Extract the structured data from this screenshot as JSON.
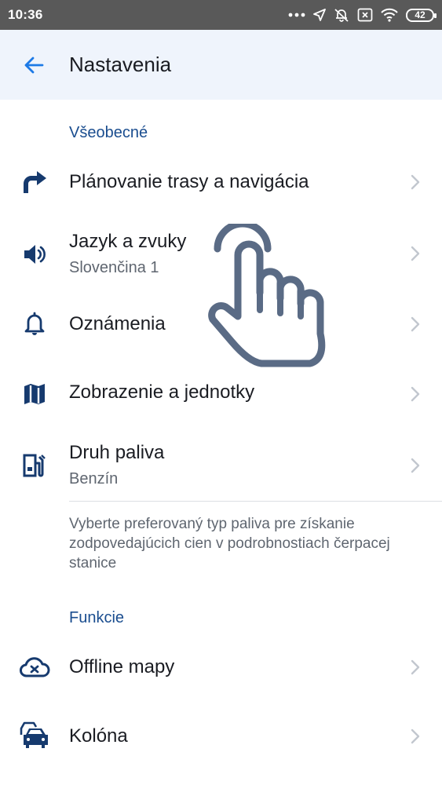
{
  "status_bar": {
    "time": "10:36",
    "battery": "42",
    "icons": [
      "more-dots-icon",
      "location-arrow-icon",
      "bell-off-icon",
      "sim-x-icon",
      "wifi-icon",
      "battery-icon"
    ]
  },
  "app_bar": {
    "back_icon": "arrow-left-icon",
    "title": "Nastavenia"
  },
  "sections": {
    "general": "Všeobecné",
    "features": "Funkcie"
  },
  "items": {
    "route": {
      "title": "Plánovanie trasy a navigácia",
      "icon": "turn-right-icon"
    },
    "language": {
      "title": "Jazyk a zvuky",
      "subtitle": "Slovenčina 1",
      "icon": "speaker-icon"
    },
    "notifications": {
      "title": "Oznámenia",
      "icon": "bell-icon"
    },
    "display": {
      "title": "Zobrazenie a jednotky",
      "icon": "map-icon"
    },
    "fuel": {
      "title": "Druh paliva",
      "subtitle": "Benzín",
      "icon": "fuel-station-icon"
    },
    "offline_maps": {
      "title": "Offline mapy",
      "icon": "cloud-x-icon"
    },
    "convoy": {
      "title": "Kolóna",
      "icon": "cars-icon"
    }
  },
  "fuel_hint": "Vyberte preferovaný typ paliva pre získanie zodpovedajúcich cien v podrobnostiach čerpacej stanice",
  "colors": {
    "status_bar": "#595959",
    "app_bar": "#eff4fc",
    "accent": "#1d7ae6",
    "section_header": "#1a4d8f",
    "icon": "#163a6e",
    "chevron": "#c2c7cf",
    "hand_overlay": "#5a6b85"
  }
}
